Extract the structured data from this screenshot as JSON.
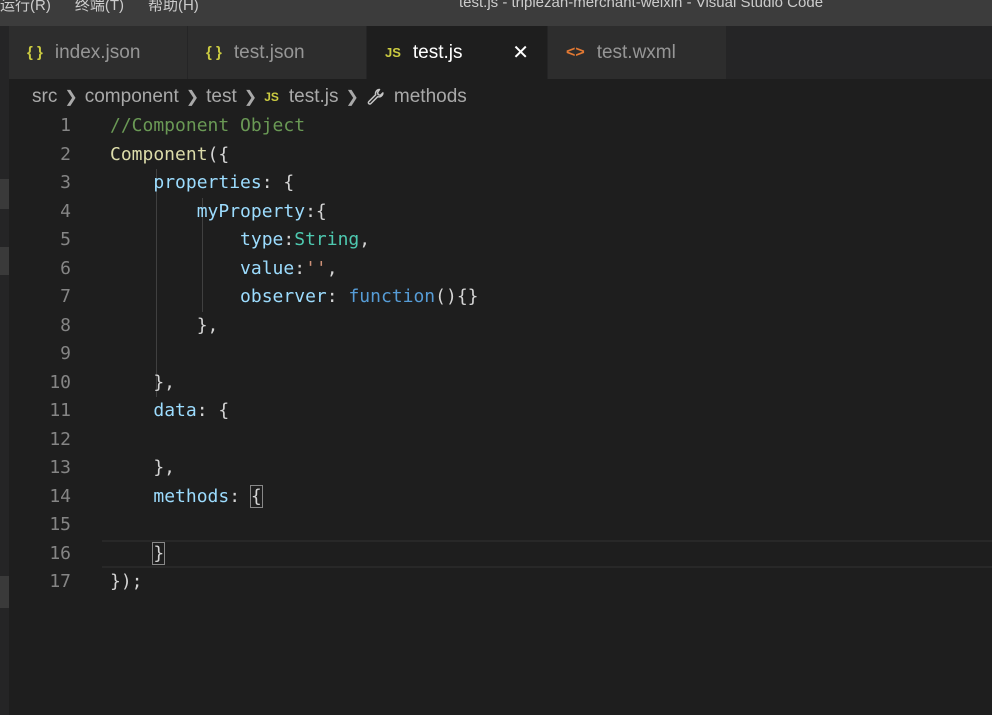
{
  "menu": {
    "items": [
      "运行(R)",
      "终端(T)",
      "帮助(H)"
    ],
    "window_title": "test.js - triplezan-merchant-weixin - Visual Studio Code"
  },
  "tabs": [
    {
      "label": "index.json",
      "icon": "json-braces-icon",
      "active": false
    },
    {
      "label": "test.json",
      "icon": "json-braces-icon",
      "active": false
    },
    {
      "label": "test.js",
      "icon": "js-file-icon",
      "active": true,
      "icon_text": "JS",
      "close": "✕"
    },
    {
      "label": "test.wxml",
      "icon": "xml-code-icon",
      "active": false
    }
  ],
  "breadcrumb": [
    "src",
    "component",
    "test",
    "test.js",
    "methods"
  ],
  "breadcrumb_js_icon": "JS",
  "colors": {
    "editor_bg": "#1e1e1e",
    "comment": "#6a9955",
    "function": "#dcdcaa",
    "property": "#9cdcfe",
    "type": "#4ec9b0",
    "string": "#ce9178",
    "keyword": "#569cd6"
  },
  "code_lines": [
    [
      {
        "t": "//Component Object",
        "c": "comment"
      }
    ],
    [
      {
        "t": "Component",
        "c": "func"
      },
      {
        "t": "({"
      }
    ],
    [
      {
        "t": "    "
      },
      {
        "t": "properties",
        "c": "prop"
      },
      {
        "t": ": {"
      }
    ],
    [
      {
        "t": "        "
      },
      {
        "t": "myProperty",
        "c": "prop"
      },
      {
        "t": ":{"
      }
    ],
    [
      {
        "t": "            "
      },
      {
        "t": "type",
        "c": "prop"
      },
      {
        "t": ":"
      },
      {
        "t": "String",
        "c": "type"
      },
      {
        "t": ","
      }
    ],
    [
      {
        "t": "            "
      },
      {
        "t": "value",
        "c": "prop"
      },
      {
        "t": ":"
      },
      {
        "t": "''",
        "c": "str"
      },
      {
        "t": ","
      }
    ],
    [
      {
        "t": "            "
      },
      {
        "t": "observer",
        "c": "prop"
      },
      {
        "t": ": "
      },
      {
        "t": "function",
        "c": "kw"
      },
      {
        "t": "(){}"
      }
    ],
    [
      {
        "t": "        },"
      }
    ],
    [],
    [
      {
        "t": "    },"
      }
    ],
    [
      {
        "t": "    "
      },
      {
        "t": "data",
        "c": "prop"
      },
      {
        "t": ": {"
      }
    ],
    [],
    [
      {
        "t": "    },"
      }
    ],
    [
      {
        "t": "    "
      },
      {
        "t": "methods",
        "c": "prop"
      },
      {
        "t": ": "
      },
      {
        "t": "{",
        "c": "bm"
      }
    ],
    [],
    [
      {
        "t": "    "
      },
      {
        "t": "}",
        "c": "bm"
      }
    ],
    [
      {
        "t": "});"
      }
    ]
  ],
  "line_numbers": [
    "1",
    "2",
    "3",
    "4",
    "5",
    "6",
    "7",
    "8",
    "9",
    "10",
    "11",
    "12",
    "13",
    "14",
    "15",
    "16",
    "17"
  ]
}
